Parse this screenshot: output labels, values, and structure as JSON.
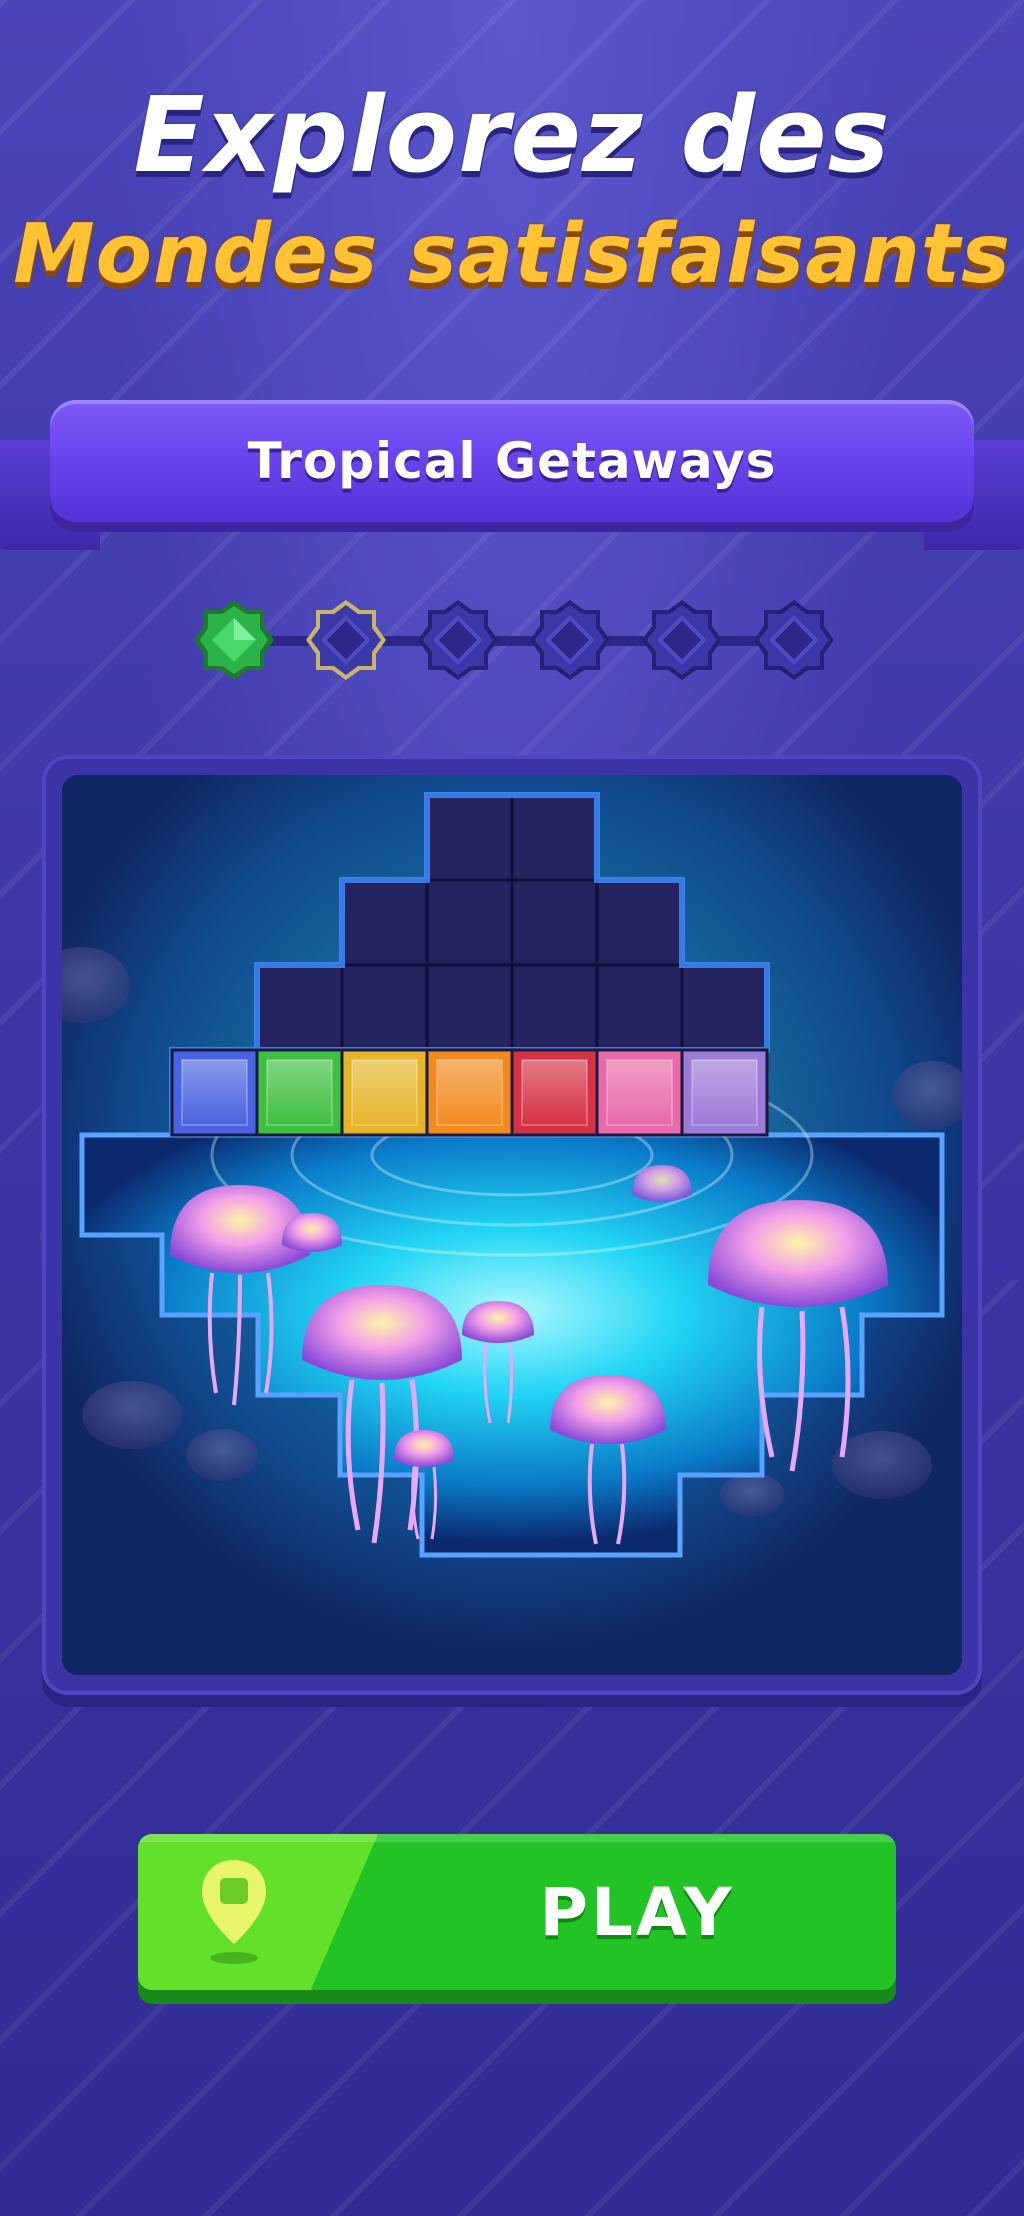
{
  "title": {
    "line1": "Explorez des",
    "line2": "Mondes satisfaisants"
  },
  "banner": {
    "label": "Tropical Getaways"
  },
  "progress": {
    "total_levels": 6,
    "completed_levels": 1,
    "icons": [
      "green-gem-icon",
      "current-level-badge-icon",
      "locked-level-badge-icon"
    ]
  },
  "board": {
    "palette_row": [
      "#4a63e0",
      "#3fbf3f",
      "#e6b52a",
      "#f28a1e",
      "#d63246",
      "#e86aa8",
      "#9c7ad8"
    ],
    "scene": "glowing-jellyfish"
  },
  "play_button": {
    "label": "PLAY",
    "icon": "map-pin-icon",
    "color": "#21c424"
  },
  "colors": {
    "background": "#3f3aa8",
    "title_yellow": "#ffc233",
    "ribbon": "#6a45ee",
    "board_frame": "#3a34a6"
  }
}
